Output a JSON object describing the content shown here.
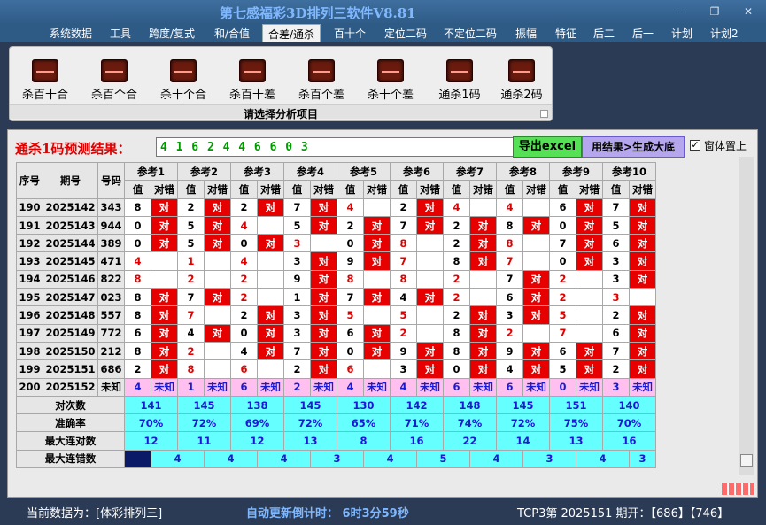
{
  "window": {
    "title": "第七感福彩3D排列三软件V8.81"
  },
  "menu": [
    "系统数据",
    "工具",
    "跨度/复式",
    "和/合值",
    "合差/通杀",
    "百十个",
    "定位二码",
    "不定位二码",
    "振幅",
    "特征",
    "后二",
    "后一",
    "计划",
    "计划2"
  ],
  "menu_active": "合差/通杀",
  "ribbon": {
    "items": [
      "杀百十合",
      "杀百个合",
      "杀十个合",
      "杀百十差",
      "杀百个差",
      "杀十个差",
      "通杀1码",
      "通杀2码"
    ],
    "caption": "请选择分析项目"
  },
  "prediction": {
    "label": "通杀1码预测结果：",
    "value": "4 1 6 2 4 4 6 6 0 3",
    "excel_button": "导出excel",
    "generate_button": "用结果>生成大底",
    "topmost_label": "窗体置上",
    "topmost_checked": "✓"
  },
  "table": {
    "fixed_headers": [
      "序号",
      "期号",
      "号码"
    ],
    "ref_groups": [
      "参考1",
      "参考2",
      "参考3",
      "参考4",
      "参考5",
      "参考6",
      "参考7",
      "参考8",
      "参考9",
      "参考10"
    ],
    "sub_value": "值",
    "sub_result": "对错",
    "hit_text": "对",
    "rows": [
      {
        "idx": "190",
        "period": "2025142",
        "num": "343",
        "vals": [
          "8",
          "2",
          "2",
          "7",
          "4",
          "2",
          "4",
          "4",
          "6",
          "7"
        ],
        "hits": [
          1,
          1,
          1,
          1,
          0,
          1,
          0,
          0,
          1,
          1
        ]
      },
      {
        "idx": "191",
        "period": "2025143",
        "num": "944",
        "vals": [
          "0",
          "5",
          "4",
          "5",
          "2",
          "7",
          "2",
          "8",
          "0",
          "5"
        ],
        "hits": [
          1,
          1,
          0,
          1,
          1,
          1,
          1,
          1,
          1,
          1
        ]
      },
      {
        "idx": "192",
        "period": "2025144",
        "num": "389",
        "vals": [
          "0",
          "5",
          "0",
          "3",
          "0",
          "8",
          "2",
          "8",
          "7",
          "6"
        ],
        "hits": [
          1,
          1,
          1,
          0,
          1,
          0,
          1,
          0,
          1,
          1
        ]
      },
      {
        "idx": "193",
        "period": "2025145",
        "num": "471",
        "vals": [
          "4",
          "1",
          "4",
          "3",
          "9",
          "7",
          "8",
          "7",
          "0",
          "3"
        ],
        "hits": [
          0,
          0,
          0,
          1,
          1,
          0,
          1,
          0,
          1,
          1
        ]
      },
      {
        "idx": "194",
        "period": "2025146",
        "num": "822",
        "vals": [
          "8",
          "2",
          "2",
          "9",
          "8",
          "8",
          "2",
          "7",
          "2",
          "3"
        ],
        "hits": [
          0,
          0,
          0,
          1,
          0,
          0,
          0,
          1,
          0,
          1
        ]
      },
      {
        "idx": "195",
        "period": "2025147",
        "num": "023",
        "vals": [
          "8",
          "7",
          "2",
          "1",
          "7",
          "4",
          "2",
          "6",
          "2",
          "3"
        ],
        "hits": [
          1,
          1,
          0,
          1,
          1,
          1,
          0,
          1,
          0,
          0
        ]
      },
      {
        "idx": "196",
        "period": "2025148",
        "num": "557",
        "vals": [
          "8",
          "7",
          "2",
          "3",
          "5",
          "5",
          "2",
          "3",
          "5",
          "2"
        ],
        "hits": [
          1,
          0,
          1,
          1,
          0,
          0,
          1,
          1,
          0,
          1
        ]
      },
      {
        "idx": "197",
        "period": "2025149",
        "num": "772",
        "vals": [
          "6",
          "4",
          "0",
          "3",
          "6",
          "2",
          "8",
          "2",
          "7",
          "6"
        ],
        "hits": [
          1,
          1,
          1,
          1,
          1,
          0,
          1,
          0,
          0,
          1
        ]
      },
      {
        "idx": "198",
        "period": "2025150",
        "num": "212",
        "vals": [
          "8",
          "2",
          "4",
          "7",
          "0",
          "9",
          "8",
          "9",
          "6",
          "7"
        ],
        "hits": [
          1,
          0,
          1,
          1,
          1,
          1,
          1,
          1,
          1,
          1
        ]
      },
      {
        "idx": "199",
        "period": "2025151",
        "num": "686",
        "vals": [
          "2",
          "8",
          "6",
          "2",
          "6",
          "3",
          "0",
          "4",
          "5",
          "2"
        ],
        "hits": [
          1,
          0,
          0,
          1,
          0,
          1,
          1,
          1,
          1,
          1
        ]
      }
    ],
    "future_row": {
      "idx": "200",
      "period": "2025152",
      "num": "未知",
      "vals": [
        "4",
        "1",
        "6",
        "2",
        "4",
        "4",
        "6",
        "6",
        "0",
        "3"
      ],
      "result": "未知"
    },
    "stats": [
      {
        "label": "对次数",
        "values": [
          "141",
          "145",
          "138",
          "145",
          "130",
          "142",
          "148",
          "145",
          "151",
          "140"
        ]
      },
      {
        "label": "准确率",
        "values": [
          "70%",
          "72%",
          "69%",
          "72%",
          "65%",
          "71%",
          "74%",
          "72%",
          "75%",
          "70%"
        ]
      },
      {
        "label": "最大连对数",
        "values": [
          "12",
          "11",
          "12",
          "13",
          "8",
          "16",
          "22",
          "14",
          "13",
          "16"
        ]
      },
      {
        "label": "最大连错数",
        "values": [
          "",
          "4",
          "4",
          "4",
          "3",
          "4",
          "5",
          "4",
          "3",
          "4",
          "3"
        ]
      }
    ]
  },
  "status": {
    "data_source": "当前数据为：[体彩排列三]",
    "countdown": "自动更新倒计时： 6时3分59秒",
    "period_info": "TCP3第 2025151 期开：【686】【746】"
  }
}
